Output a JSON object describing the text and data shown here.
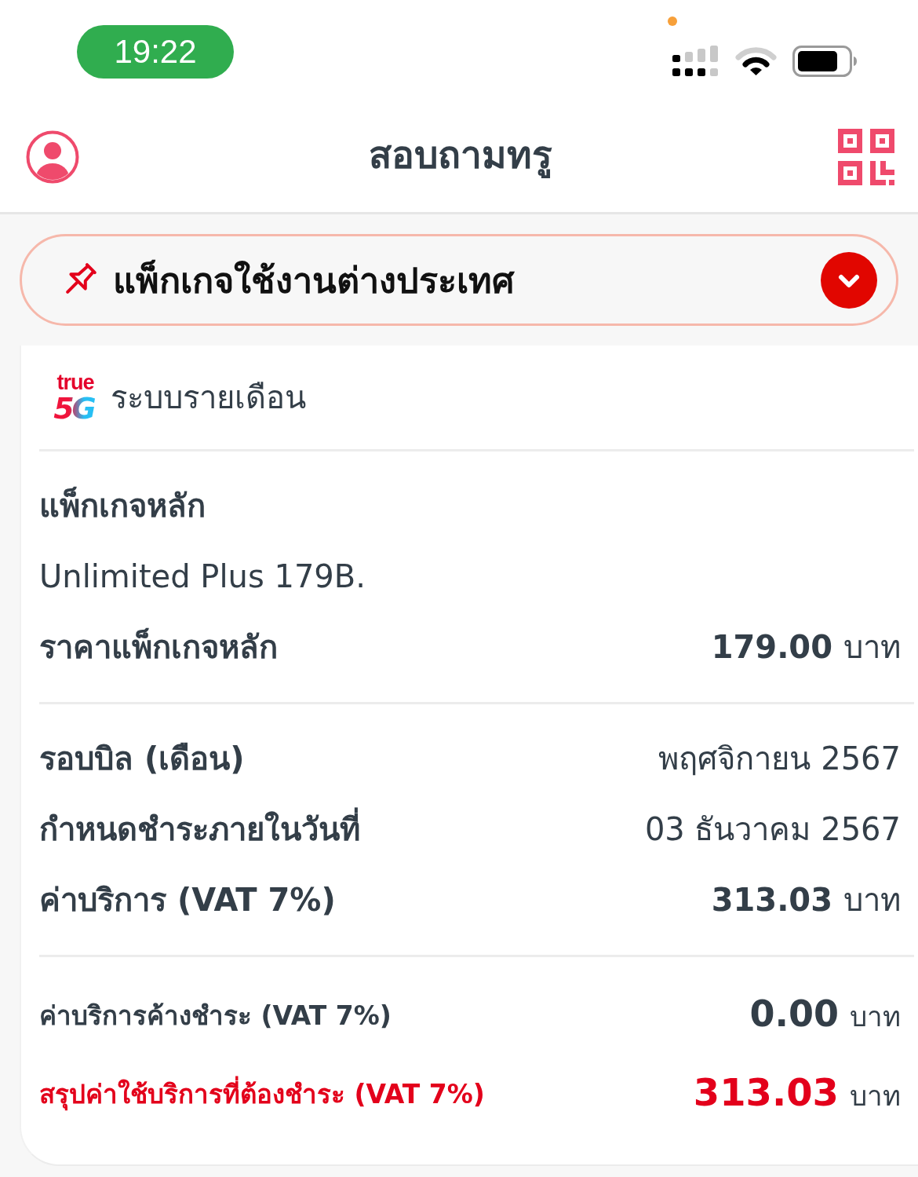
{
  "status_bar": {
    "time": "19:22"
  },
  "header": {
    "title": "สอบถามทรู"
  },
  "package_selector": {
    "label": "แพ็กเกจใช้งานต่างประเทศ",
    "expanded": false
  },
  "account": {
    "logo": {
      "word": "true",
      "mark": "5G"
    },
    "plan_type": "ระบบรายเดือน"
  },
  "sections": [
    {
      "heading": "แพ็กเกจหลัก",
      "subtitle": "Unlimited Plus 179B.",
      "rows": [
        {
          "kind": "amount",
          "label": "ราคาแพ็กเกจหลัก",
          "value": "179.00",
          "unit": "บาท"
        }
      ]
    },
    {
      "rows": [
        {
          "kind": "text",
          "label": "รอบบิล (เดือน)",
          "value": "พฤศจิกายน 2567"
        },
        {
          "kind": "text",
          "label": "กำหนดชำระภายในวันที่",
          "value": "03 ธันวาคม 2567"
        },
        {
          "kind": "amount",
          "label": "ค่าบริการ (VAT 7%)",
          "value": "313.03",
          "unit": "บาท"
        }
      ]
    },
    {
      "rows": [
        {
          "kind": "outstanding",
          "label": "ค่าบริการค้างชำระ (VAT 7%)",
          "value": "0.00",
          "unit": "บาท"
        },
        {
          "kind": "total",
          "label": "สรุปค่าใช้บริการที่ต้องชำระ (VAT 7%)",
          "value": "313.03",
          "unit": "บาท"
        }
      ]
    }
  ]
}
